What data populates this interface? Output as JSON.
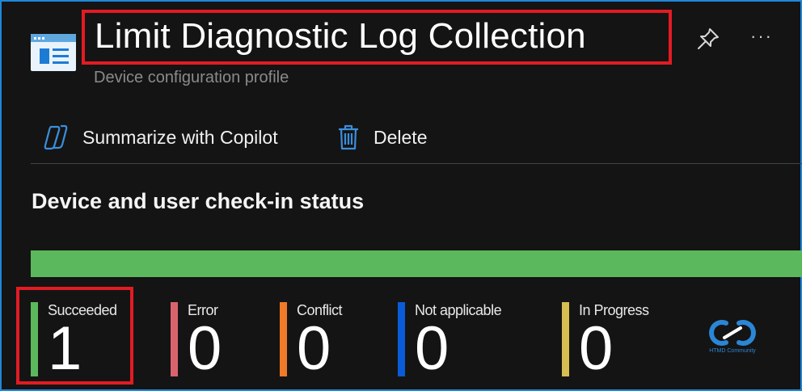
{
  "header": {
    "title": "Limit Diagnostic Log Collection",
    "subtitle": "Device configuration profile",
    "app_icon": "config-profile-icon",
    "pin_icon": "pin-icon",
    "more_label": "···"
  },
  "toolbar": {
    "copilot_label": "Summarize with Copilot",
    "copilot_icon": "copilot-icon",
    "delete_label": "Delete",
    "delete_icon": "trash-icon"
  },
  "status_section": {
    "heading": "Device and user check-in status",
    "progress_fraction": 1.0,
    "progress_color": "#5cb85c",
    "stats": [
      {
        "label": "Succeeded",
        "value": "1",
        "color": "#5cb85c"
      },
      {
        "label": "Error",
        "value": "0",
        "color": "#d9636d"
      },
      {
        "label": "Conflict",
        "value": "0",
        "color": "#f07a28"
      },
      {
        "label": "Not applicable",
        "value": "0",
        "color": "#0a5bd8"
      },
      {
        "label": "In Progress",
        "value": "0",
        "color": "#d7bd52"
      }
    ]
  },
  "watermark": {
    "text": "HTMD Community"
  },
  "colors": {
    "background": "#141414",
    "frame_border": "#1e88d8",
    "highlight": "#e31b23",
    "accent": "#2b86d6"
  }
}
